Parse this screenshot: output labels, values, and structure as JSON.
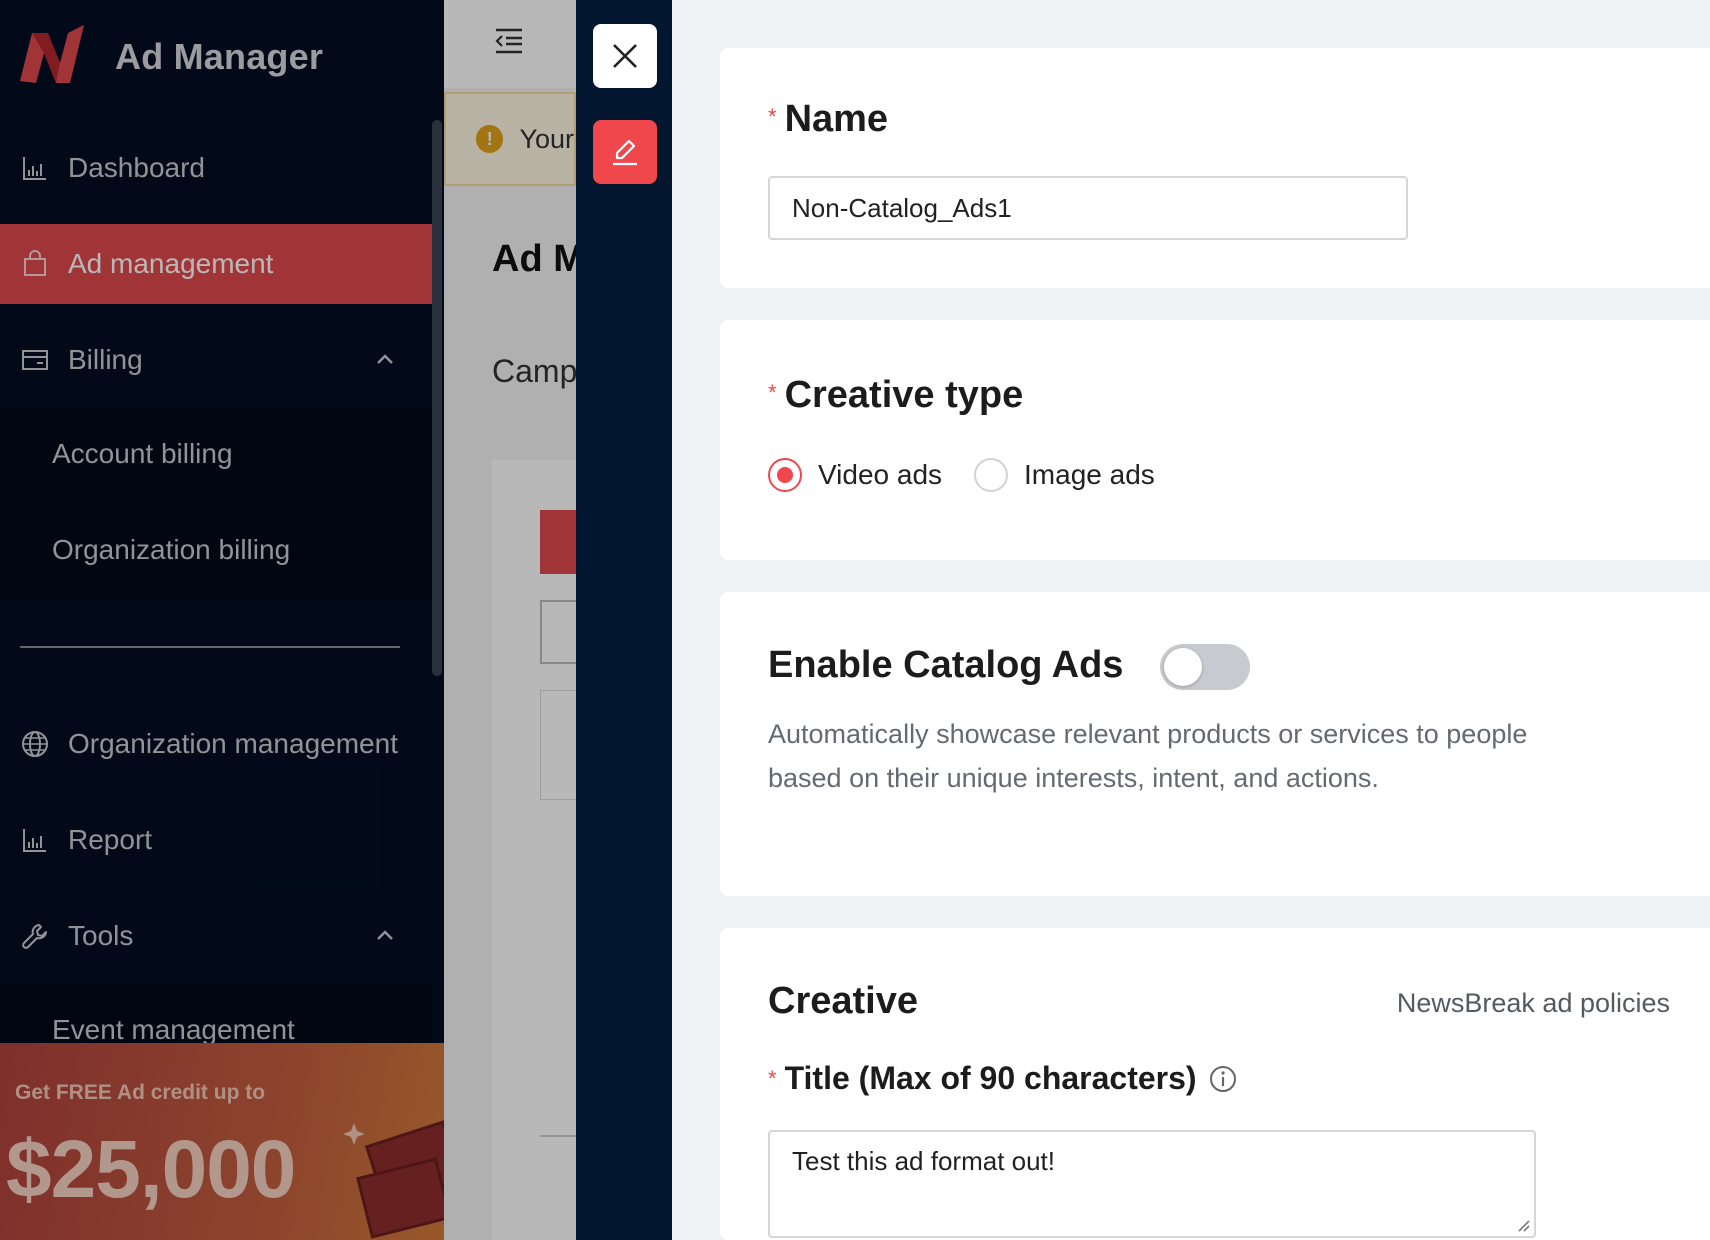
{
  "app": {
    "title": "Ad Manager"
  },
  "sidebar": {
    "items": [
      {
        "label": "Dashboard",
        "icon": "bar-chart-icon"
      },
      {
        "label": "Ad management",
        "icon": "shopping-bag-icon",
        "active": true
      },
      {
        "label": "Billing",
        "icon": "credit-card-icon",
        "expanded": true
      },
      {
        "label": "Organization management",
        "icon": "globe-icon"
      },
      {
        "label": "Report",
        "icon": "bar-chart-icon"
      },
      {
        "label": "Tools",
        "icon": "wrench-icon",
        "expanded": true
      }
    ],
    "billing_sub": [
      "Account billing",
      "Organization billing"
    ],
    "tools_sub": [
      "Event management"
    ]
  },
  "promo": {
    "text": "Get FREE Ad credit up to",
    "amount": "$25,000"
  },
  "background": {
    "warning_text": "Your",
    "heading": "Ad M",
    "tab": "Camp"
  },
  "drawer": {
    "name": {
      "label": "Name",
      "value": "Non-Catalog_Ads1"
    },
    "creative_type": {
      "label": "Creative type",
      "options": [
        {
          "label": "Video ads",
          "selected": true
        },
        {
          "label": "Image ads",
          "selected": false
        }
      ]
    },
    "catalog": {
      "label": "Enable Catalog Ads",
      "enabled": false,
      "description": "Automatically showcase relevant products or services to people based on their unique interests, intent, and actions."
    },
    "creative": {
      "label": "Creative",
      "policies_link": "NewsBreak ad policies",
      "title_label": "Title (Max of 90 characters)",
      "title_value": "Test this ad format out!"
    }
  },
  "colors": {
    "accent": "#f0474d",
    "sidebar_bg": "#030f24",
    "active_item": "#e0484c"
  }
}
